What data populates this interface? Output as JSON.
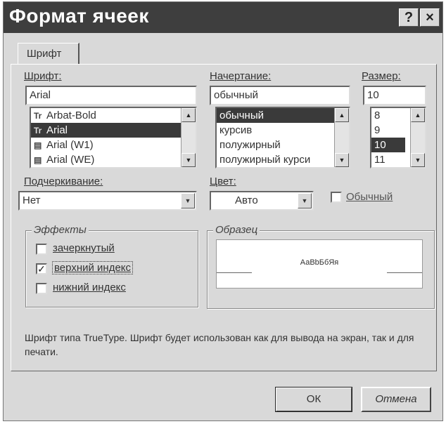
{
  "dialog": {
    "title": "Формат ячеек",
    "help_label": "?",
    "close_label": "×"
  },
  "tabs": [
    {
      "label": "Шрифт",
      "active": true
    }
  ],
  "font": {
    "label": "Шрифт:",
    "value": "Arial",
    "list": [
      {
        "icon": "Tr",
        "label": "Arbat-Bold",
        "selected": false
      },
      {
        "icon": "Tr",
        "label": "Arial",
        "selected": true
      },
      {
        "icon": "▤",
        "label": "Arial (W1)",
        "selected": false
      },
      {
        "icon": "▤",
        "label": "Arial (WE)",
        "selected": false
      }
    ]
  },
  "style": {
    "label": "Начертание:",
    "value": "обычный",
    "list": [
      {
        "label": "обычный",
        "selected": true
      },
      {
        "label": "курсив",
        "selected": false
      },
      {
        "label": "полужирный",
        "selected": false
      },
      {
        "label": "полужирный курси",
        "selected": false
      }
    ]
  },
  "size": {
    "label": "Размер:",
    "value": "10",
    "list": [
      {
        "label": "8",
        "selected": false
      },
      {
        "label": "9",
        "selected": false
      },
      {
        "label": "10",
        "selected": true
      },
      {
        "label": "11",
        "selected": false
      }
    ]
  },
  "underline": {
    "label": "Подчеркивание:",
    "value": "Нет"
  },
  "color": {
    "label": "Цвет:",
    "value": "Авто"
  },
  "normal": {
    "label": "Обычный",
    "checked": false
  },
  "effects": {
    "title": "Эффекты",
    "items": [
      {
        "label": "зачеркнутый",
        "checked": false
      },
      {
        "label": "верхний индекс",
        "checked": true
      },
      {
        "label": "нижний индекс",
        "checked": false
      }
    ]
  },
  "sample": {
    "title": "Образец",
    "text": "АаBbБбЯя"
  },
  "description": "Шрифт типа TrueType. Шрифт будет использован как для вывода на экран, так и для печати.",
  "buttons": {
    "ok": "ОК",
    "cancel": "Отмена"
  },
  "icons": {
    "scroll_up": "scroll-up-arrow-icon",
    "scroll_down": "scroll-down-arrow-icon",
    "dropdown": "chevron-down-icon",
    "checkmark": "check-icon"
  }
}
